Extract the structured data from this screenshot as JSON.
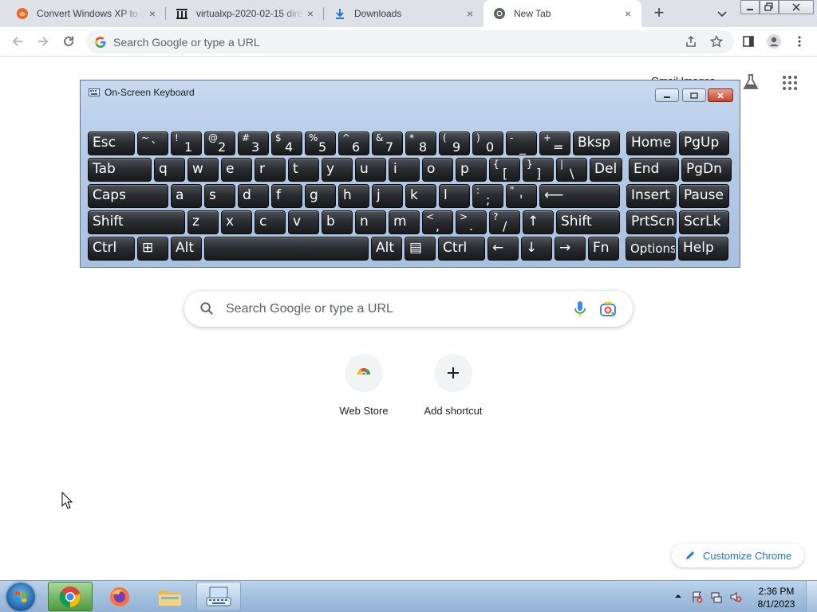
{
  "tabs": [
    {
      "title": "Convert Windows XP to a",
      "icon": "app-favicon"
    },
    {
      "title": "virtualxp-2020-02-15 dire",
      "icon": "archive-favicon"
    },
    {
      "title": "Downloads",
      "icon": "download-icon"
    },
    {
      "title": "New Tab",
      "icon": "chrome-icon"
    }
  ],
  "toolbar": {
    "omnibox_placeholder": "Search Google or type a URL"
  },
  "header": {
    "gmail_partial": "Gmail  Images"
  },
  "osk": {
    "title": "On-Screen Keyboard",
    "rows": [
      [
        {
          "l": "Esc"
        },
        {
          "t": "~",
          "b": "`"
        },
        {
          "t": "!",
          "b": "1"
        },
        {
          "t": "@",
          "b": "2"
        },
        {
          "t": "#",
          "b": "3"
        },
        {
          "t": "$",
          "b": "4"
        },
        {
          "t": "%",
          "b": "5"
        },
        {
          "t": "^",
          "b": "6"
        },
        {
          "t": "&",
          "b": "7"
        },
        {
          "t": "*",
          "b": "8"
        },
        {
          "t": "(",
          "b": "9"
        },
        {
          "t": ")",
          "b": "0"
        },
        {
          "t": "-",
          "b": "_"
        },
        {
          "t": "+",
          "b": "="
        },
        {
          "l": "Bksp"
        },
        {
          "l": "Home"
        },
        {
          "l": "PgUp"
        }
      ],
      [
        {
          "l": "Tab"
        },
        {
          "l": "q"
        },
        {
          "l": "w"
        },
        {
          "l": "e"
        },
        {
          "l": "r"
        },
        {
          "l": "t"
        },
        {
          "l": "y"
        },
        {
          "l": "u"
        },
        {
          "l": "i"
        },
        {
          "l": "o"
        },
        {
          "l": "p"
        },
        {
          "t": "{",
          "b": "["
        },
        {
          "t": "}",
          "b": "]"
        },
        {
          "t": "|",
          "b": "\\"
        },
        {
          "l": "Del"
        },
        {
          "l": "End"
        },
        {
          "l": "PgDn"
        }
      ],
      [
        {
          "l": "Caps"
        },
        {
          "l": "a"
        },
        {
          "l": "s"
        },
        {
          "l": "d"
        },
        {
          "l": "f"
        },
        {
          "l": "g"
        },
        {
          "l": "h"
        },
        {
          "l": "j"
        },
        {
          "l": "k"
        },
        {
          "l": "l"
        },
        {
          "t": ":",
          "b": ";"
        },
        {
          "t": "\"",
          "b": "'"
        },
        {
          "l": "⟵"
        },
        {
          "l": "Insert"
        },
        {
          "l": "Pause"
        }
      ],
      [
        {
          "l": "Shift"
        },
        {
          "l": "z"
        },
        {
          "l": "x"
        },
        {
          "l": "c"
        },
        {
          "l": "v"
        },
        {
          "l": "b"
        },
        {
          "l": "n"
        },
        {
          "l": "m"
        },
        {
          "t": "<",
          "b": ","
        },
        {
          "t": ">",
          "b": "."
        },
        {
          "t": "?",
          "b": "/"
        },
        {
          "l": "↑"
        },
        {
          "l": "Shift"
        },
        {
          "l": "PrtScn"
        },
        {
          "l": "ScrLk"
        }
      ],
      [
        {
          "l": "Ctrl"
        },
        {
          "l": "⊞"
        },
        {
          "l": "Alt"
        },
        {
          "l": ""
        },
        {
          "l": "Alt"
        },
        {
          "l": "▤"
        },
        {
          "l": "Ctrl"
        },
        {
          "l": "←"
        },
        {
          "l": "↓"
        },
        {
          "l": "→"
        },
        {
          "l": "Fn"
        },
        {
          "l": "Options"
        },
        {
          "l": "Help"
        }
      ]
    ]
  },
  "search": {
    "placeholder": "Search Google or type a URL"
  },
  "shortcuts": [
    {
      "label": "Web Store",
      "icon": "web-store-icon"
    },
    {
      "label": "Add shortcut",
      "icon": "plus-icon"
    }
  ],
  "customize_label": "Customize Chrome",
  "taskbar": {
    "time": "2:36 PM",
    "date": "8/1/2023",
    "items": [
      "chrome-icon",
      "firefox-icon",
      "file-explorer-icon",
      "on-screen-keyboard-icon"
    ]
  },
  "colors": {
    "accent": "#1a73e8",
    "tabstrip": "#dee1e6",
    "key_face": "#2b2e31",
    "osk_frame": "#b4cbe6"
  }
}
